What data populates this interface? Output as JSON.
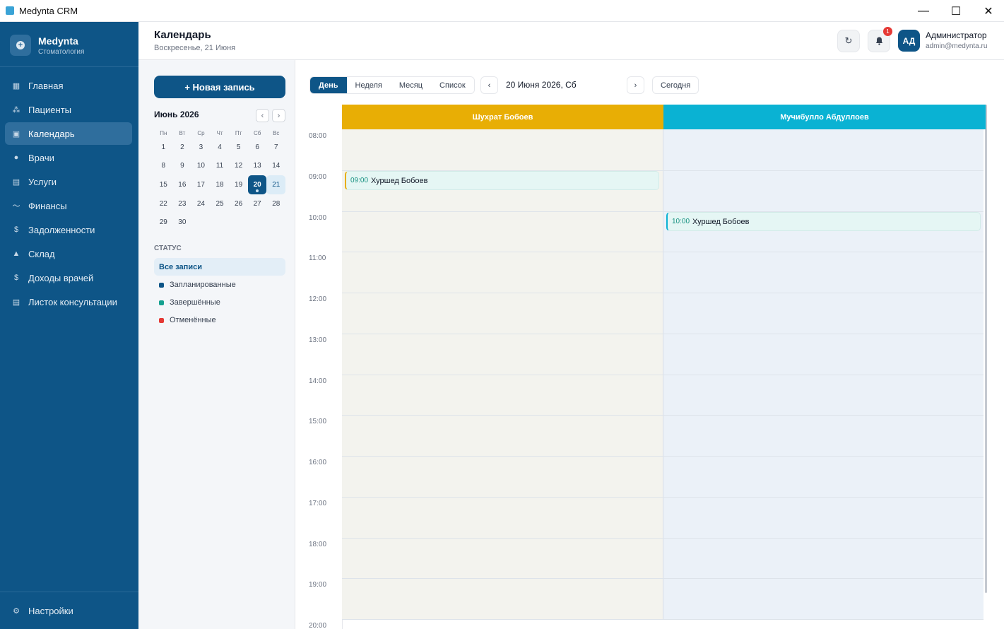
{
  "window": {
    "title": "Medynta CRM",
    "controls": {
      "minimize": "—",
      "maximize": "☐",
      "close": "✕"
    }
  },
  "brand": {
    "name": "Medynta",
    "subtitle": "Стоматология",
    "logo_icon": "plus-circle-icon"
  },
  "sidebar": {
    "items": [
      {
        "label": "Главная",
        "icon": "dashboard-icon",
        "active": false
      },
      {
        "label": "Пациенты",
        "icon": "users-icon",
        "active": false
      },
      {
        "label": "Календарь",
        "icon": "calendar-icon",
        "active": true
      },
      {
        "label": "Врачи",
        "icon": "doctor-icon",
        "active": false
      },
      {
        "label": "Услуги",
        "icon": "services-icon",
        "active": false
      },
      {
        "label": "Финансы",
        "icon": "chart-line-icon",
        "active": false
      },
      {
        "label": "Задолженности",
        "icon": "dollar-icon",
        "active": false
      },
      {
        "label": "Склад",
        "icon": "warehouse-icon",
        "active": false
      },
      {
        "label": "Доходы врачей",
        "icon": "dollar-icon",
        "active": false
      },
      {
        "label": "Листок консультации",
        "icon": "document-icon",
        "active": false
      }
    ],
    "settings": {
      "label": "Настройки",
      "icon": "gear-icon"
    }
  },
  "header": {
    "title": "Календарь",
    "subtitle": "Воскресенье, 21 Июня",
    "notifications_count": "1",
    "user": {
      "initials": "АД",
      "name": "Администратор",
      "email": "admin@medynta.ru"
    }
  },
  "left_panel": {
    "new_button": "+ Новая запись",
    "mini_calendar": {
      "title": "Июнь 2026",
      "prev": "‹",
      "next": "›",
      "weekdays": [
        "Пн",
        "Вт",
        "Ср",
        "Чт",
        "Пт",
        "Сб",
        "Вс"
      ],
      "weeks": [
        [
          "1",
          "2",
          "3",
          "4",
          "5",
          "6",
          "7"
        ],
        [
          "8",
          "9",
          "10",
          "11",
          "12",
          "13",
          "14"
        ],
        [
          "15",
          "16",
          "17",
          "18",
          "19",
          "20",
          "21"
        ],
        [
          "22",
          "23",
          "24",
          "25",
          "26",
          "27",
          "28"
        ],
        [
          "29",
          "30",
          "",
          "",
          "",
          "",
          ""
        ]
      ],
      "selected_day": "20",
      "today": "21"
    },
    "status": {
      "title": "СТАТУС",
      "all": "Все записи",
      "items": [
        {
          "label": "Запланированные",
          "color": "#0e5587"
        },
        {
          "label": "Завершённые",
          "color": "#14a08f"
        },
        {
          "label": "Отменённые",
          "color": "#e53935"
        }
      ]
    }
  },
  "calendar": {
    "views": [
      {
        "label": "День",
        "active": true
      },
      {
        "label": "Неделя",
        "active": false
      },
      {
        "label": "Месяц",
        "active": false
      },
      {
        "label": "Список",
        "active": false
      }
    ],
    "prev": "‹",
    "next": "›",
    "current_date": "20 Июня 2026, Сб",
    "today_button": "Сегодня",
    "doctors": [
      {
        "name": "Шухрат Бобоев",
        "color": "#e8ae05",
        "bg": "#f3f3ee"
      },
      {
        "name": "Мучибулло Абдуллоев",
        "color": "#0ab2d3",
        "bg": "#ebf1f8"
      }
    ],
    "hours": [
      "08:00",
      "09:00",
      "10:00",
      "11:00",
      "12:00",
      "13:00",
      "14:00",
      "15:00",
      "16:00",
      "17:00",
      "18:00",
      "19:00",
      "20:00"
    ],
    "events": [
      {
        "doctor": 0,
        "time": "09:00",
        "patient": "Хуршед Бобоев",
        "accent": "#e8ae05"
      },
      {
        "doctor": 1,
        "time": "10:00",
        "patient": "Хуршед Бобоев",
        "accent": "#0ab2d3"
      }
    ]
  }
}
